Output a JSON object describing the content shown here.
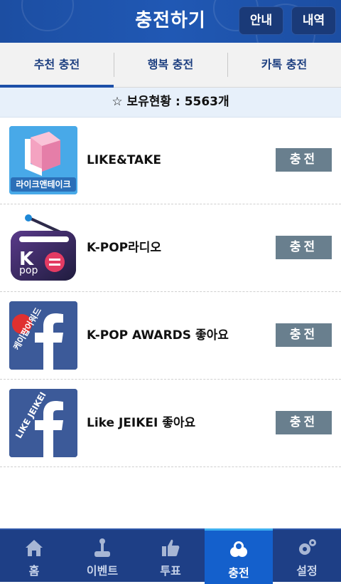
{
  "header": {
    "title": "충전하기",
    "guide_label": "안내",
    "history_label": "내역"
  },
  "tabs": [
    {
      "label": "추천 충전",
      "active": true
    },
    {
      "label": "행복 충전",
      "active": false
    },
    {
      "label": "카톡 충전",
      "active": false
    }
  ],
  "holding": {
    "text": "☆ 보유현황 : 5563개"
  },
  "items": [
    {
      "name": "LIKE&TAKE",
      "logo_text": "라이크앤테이크",
      "button": "충전",
      "icon": "like-and-take-logo"
    },
    {
      "name": "K-POP라디오",
      "logo_text": "pop",
      "button": "충전",
      "icon": "kpop-radio-logo"
    },
    {
      "name": "K-POP AWARDS 좋아요",
      "logo_text": "케이팝어워드",
      "button": "충전",
      "icon": "facebook-kpop-awards-logo"
    },
    {
      "name": "Like JEIKEI 좋아요",
      "logo_text": "LIKE JEIKEI",
      "button": "충전",
      "icon": "facebook-like-jeikei-logo"
    }
  ],
  "nav": [
    {
      "label": "홈",
      "icon": "home-icon",
      "active": false
    },
    {
      "label": "이벤트",
      "icon": "joystick-icon",
      "active": false
    },
    {
      "label": "투표",
      "icon": "thumbs-up-icon",
      "active": false
    },
    {
      "label": "충전",
      "icon": "coins-icon",
      "active": true
    },
    {
      "label": "설정",
      "icon": "gear-icon",
      "active": false
    }
  ],
  "colors": {
    "header_bg": "#1c4ea2",
    "tab_text": "#1d3f80",
    "button_bg": "#697f8e",
    "nav_bg": "#1e3f86",
    "nav_active": "#1460cc"
  }
}
